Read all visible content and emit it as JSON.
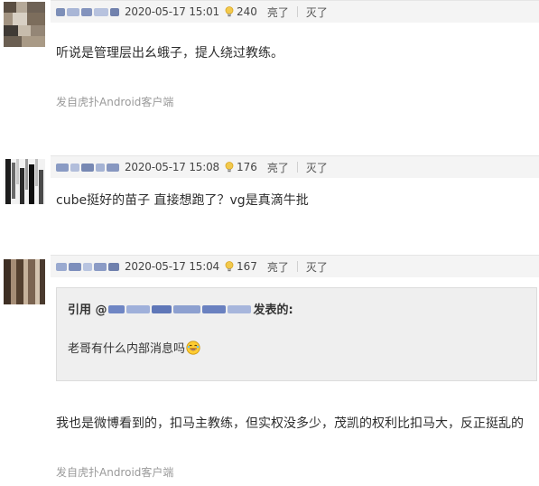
{
  "posts": [
    {
      "date": "2020-05-17 15:01",
      "likes": "240",
      "light_label": "亮了",
      "dark_label": "灭了",
      "content": "听说是管理层出幺蛾子，提人绕过教练。",
      "source": "发自虎扑Android客户端"
    },
    {
      "date": "2020-05-17 15:08",
      "likes": "176",
      "light_label": "亮了",
      "dark_label": "灭了",
      "content": "cube挺好的苗子 直接想跑了？vg是真滴牛批"
    },
    {
      "date": "2020-05-17 15:04",
      "likes": "167",
      "light_label": "亮了",
      "dark_label": "灭了",
      "quote": {
        "prefix": "引用 @",
        "suffix": "发表的:",
        "text": "老哥有什么内部消息吗"
      },
      "content": "我也是微博看到的，扣马主教练，但实权没多少，茂凯的权利比扣马大，反正挺乱的",
      "source": "发自虎扑Android客户端"
    }
  ],
  "icons": {
    "like": "lightbulb-icon",
    "emoji": "laughing-emoji-icon"
  },
  "colors": {
    "meta_bar_bg": "#f4f4f4",
    "quote_bg": "#efefef",
    "source_text": "#9a9a9a"
  }
}
